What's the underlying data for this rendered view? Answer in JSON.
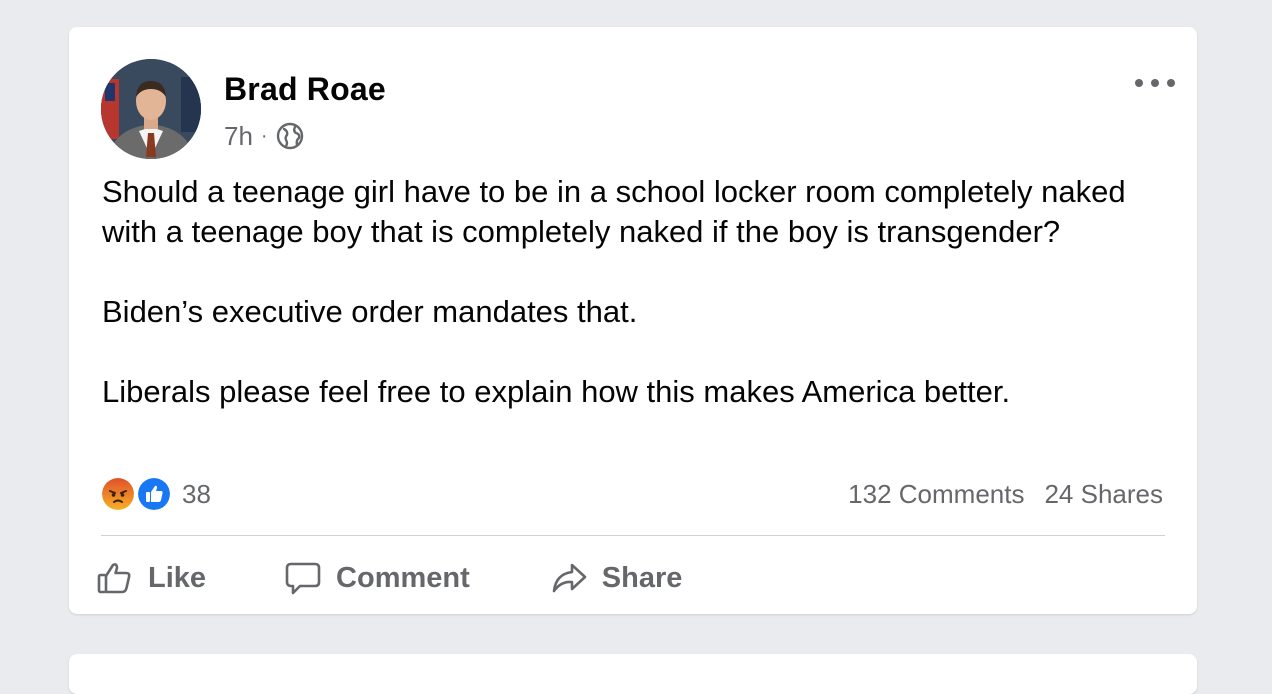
{
  "post": {
    "author": "Brad Roae",
    "time": "7h",
    "separator": "·",
    "privacy_icon": "globe-icon",
    "more_icon": "more-options-icon",
    "paragraphs": [
      "Should a teenage girl have to be in a school locker room completely naked with a teenage boy that is completely naked if the boy is transgender?",
      "Biden’s executive order mandates that.",
      "Liberals please feel free to explain how this makes America better."
    ],
    "reactions": {
      "icons": [
        "angry-reaction-icon",
        "like-reaction-icon"
      ],
      "count": "38"
    },
    "comments_count": "132 Comments",
    "shares_count": "24 Shares",
    "actions": {
      "like_label": "Like",
      "comment_label": "Comment",
      "share_label": "Share"
    }
  },
  "colors": {
    "page_background": "#e9ebee",
    "card": "#ffffff",
    "text_primary": "#050505",
    "text_secondary": "#65676b",
    "like_blue": "#1877f2",
    "angry_orange": "#f0721c"
  }
}
